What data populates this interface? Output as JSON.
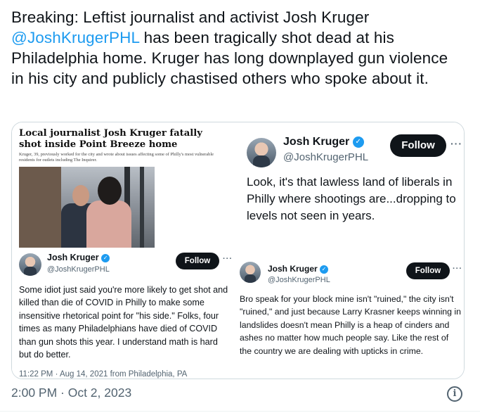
{
  "tweet": {
    "text_before": "Breaking: Leftist journalist and activist Josh Kruger ",
    "mention": "@JoshKrugerPHL",
    "text_after": " has been tragically shot dead at his Philadelphia home. Kruger has long downplayed gun violence in his city and publicly chastised others who spoke about it.",
    "time": "2:00 PM · Oct 2, 2023"
  },
  "news_clip": {
    "headline": "Local journalist Josh Kruger fatally shot inside Point Breeze home",
    "subhead": "Kruger, 39, previously worked for the city and wrote about issues affecting some of Philly's most vulnerable residents for outlets including The Inquirer."
  },
  "tweet_top_right": {
    "name": "Josh Kruger",
    "handle": "@JoshKrugerPHL",
    "follow_label": "Follow",
    "more": "···",
    "body": "Look, it's that lawless land of liberals in Philly where shootings are...dropping to levels not seen in years."
  },
  "tweet_bottom_left": {
    "name": "Josh Kruger",
    "handle": "@JoshKrugerPHL",
    "follow_label": "Follow",
    "more": "···",
    "body": "Some idiot just said you're more likely to get shot and killed than die of COVID in Philly to make some insensitive rhetorical point for \"his side.\" Folks, four times as many Philadelphians have died of COVID than gun shots this year. I understand math is hard but do better.",
    "timestamp": "11:22 PM · Aug 14, 2021 from Philadelphia, PA"
  },
  "tweet_bottom_right": {
    "name": "Josh Kruger",
    "handle": "@JoshKrugerPHL",
    "follow_label": "Follow",
    "more": "···",
    "body": "Bro speak for your block mine isn't \"ruined,\" the city isn't \"ruined,\" and just because Larry Krasner keeps winning in landslides doesn't mean Philly is a heap of cinders and ashes no matter how much people say. Like the rest of the country we are dealing with upticks in crime."
  },
  "icons": {
    "verified": "verified-badge-icon",
    "info": "info-icon"
  },
  "colors": {
    "accent": "#1d9bf0",
    "text": "#0f1419",
    "muted": "#536471",
    "border": "#cfd9de"
  }
}
